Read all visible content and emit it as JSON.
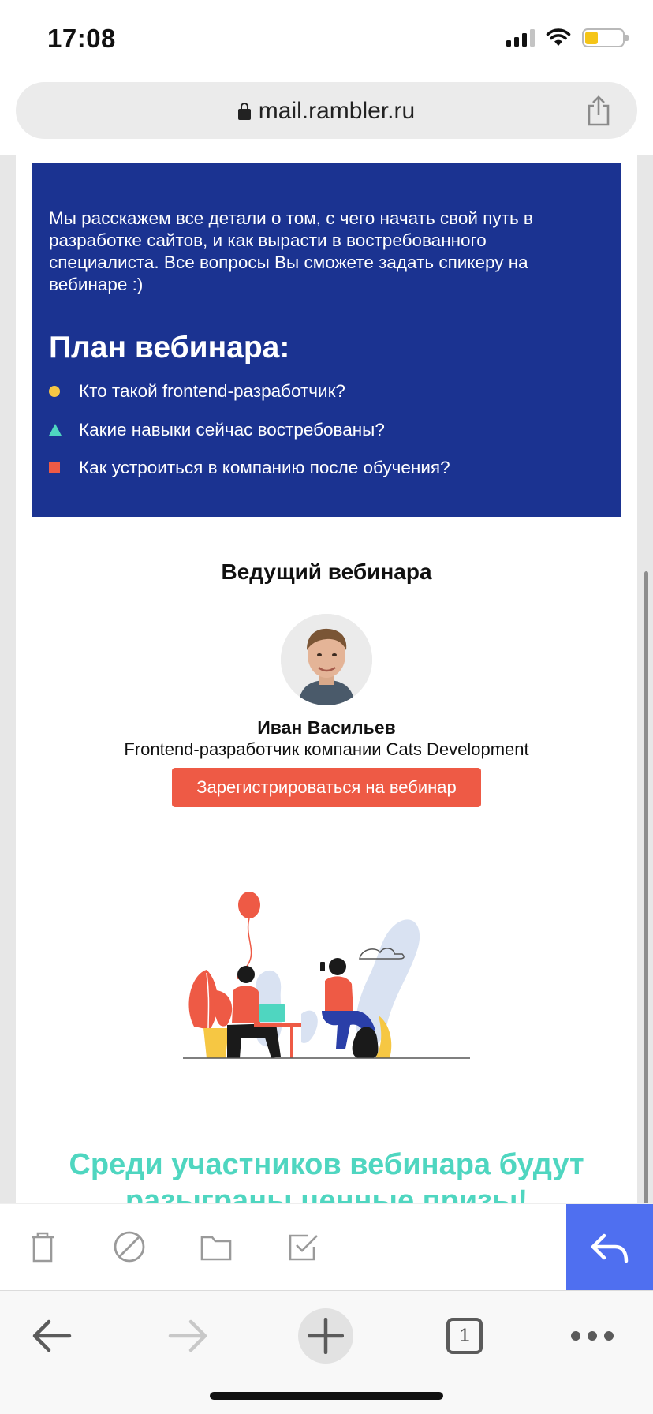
{
  "status_bar": {
    "time": "17:08"
  },
  "browser": {
    "url": "mail.rambler.ru"
  },
  "email": {
    "intro": "Мы расскажем все детали о том, с чего начать свой путь в разработке сайтов, и как вырасти в востребованного специалиста. Все вопросы Вы сможете задать спикеру на вебинаре :)",
    "plan_title": "План вебинара:",
    "plan_items": [
      {
        "label": "Кто такой frontend-разработчик?"
      },
      {
        "label": "Какие навыки сейчас востребованы?"
      },
      {
        "label": "Как устроиться в компанию после обучения?"
      }
    ],
    "host_title": "Ведущий вебинара",
    "host_name": "Иван Васильев",
    "host_role": "Frontend-разработчик компании Cats Development",
    "register_label": "Зарегистрироваться на вебинар",
    "prize_text": "Среди участников вебинара будут разыграны ценные призы!"
  },
  "tabs": {
    "count": "1"
  },
  "colors": {
    "block_bg": "#1b3391",
    "accent_red": "#ee5a45",
    "accent_teal": "#4fd6c0",
    "accent_yellow": "#f6c743",
    "reply_bg": "#4f6ff0"
  },
  "icons": {
    "status": [
      "signal-icon",
      "wifi-icon",
      "battery-icon"
    ],
    "address_bar": [
      "lock-icon",
      "share-icon"
    ],
    "mail_toolbar": [
      "trash-icon",
      "block-icon",
      "folder-icon",
      "checkbox-icon",
      "reply-icon"
    ],
    "nav_bar": [
      "back-arrow-icon",
      "forward-arrow-icon",
      "plus-icon",
      "tabs-icon",
      "more-icon"
    ]
  }
}
